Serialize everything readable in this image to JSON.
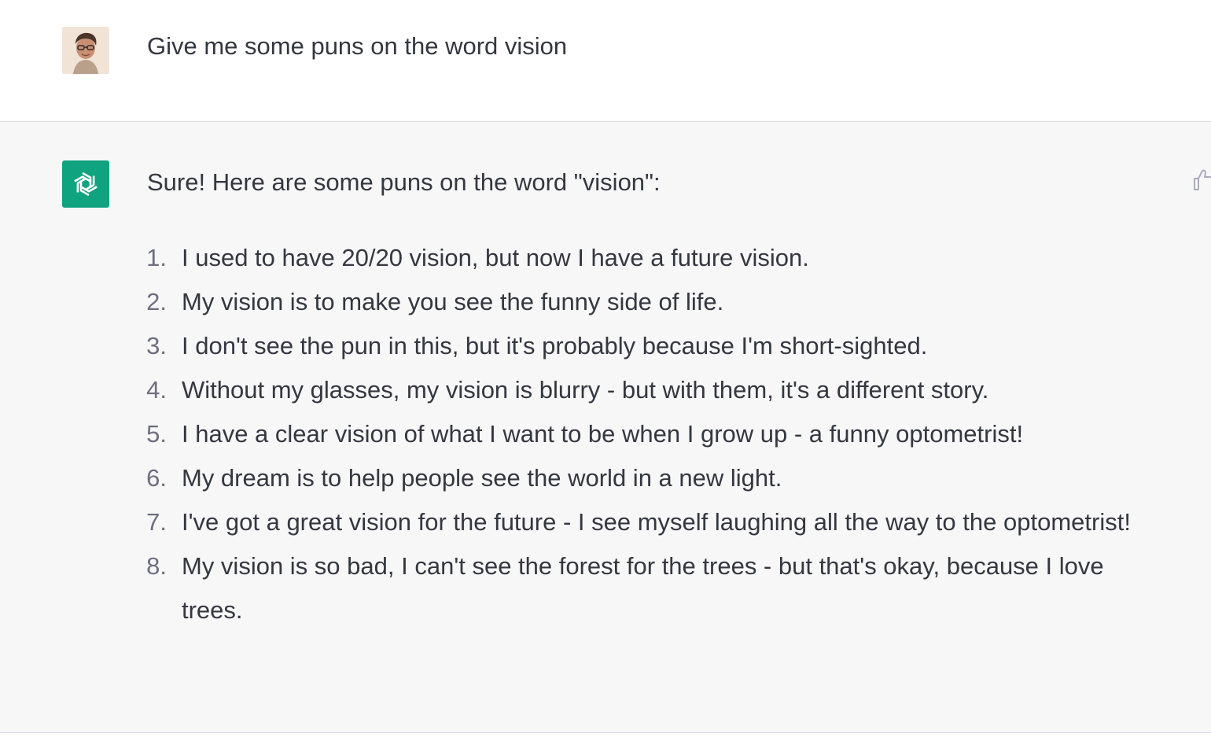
{
  "conversation": {
    "user": {
      "avatar_icon": "user-photo-avatar",
      "message": "Give me some puns on the word vision"
    },
    "assistant": {
      "avatar_icon": "openai-logo-icon",
      "accent_color": "#10a37f",
      "intro": "Sure! Here are some puns on the word \"vision\":",
      "puns": [
        {
          "num": "1.",
          "text": "I used to have 20/20 vision, but now I have a future vision."
        },
        {
          "num": "2.",
          "text": "My vision is to make you see the funny side of life."
        },
        {
          "num": "3.",
          "text": "I don't see the pun in this, but it's probably because I'm short-sighted."
        },
        {
          "num": "4.",
          "text": "Without my glasses, my vision is blurry - but with them, it's a different story."
        },
        {
          "num": "5.",
          "text": "I have a clear vision of what I want to be when I grow up - a funny optometrist!"
        },
        {
          "num": "6.",
          "text": "My dream is to help people see the world in a new light."
        },
        {
          "num": "7.",
          "text": "I've got a great vision for the future - I see myself laughing all the way to the optometrist!"
        },
        {
          "num": "8.",
          "text": "My vision is so bad, I can't see the forest for the trees - but that's okay, because I love trees."
        }
      ],
      "feedback_icon": "thumbs-up-icon"
    }
  }
}
